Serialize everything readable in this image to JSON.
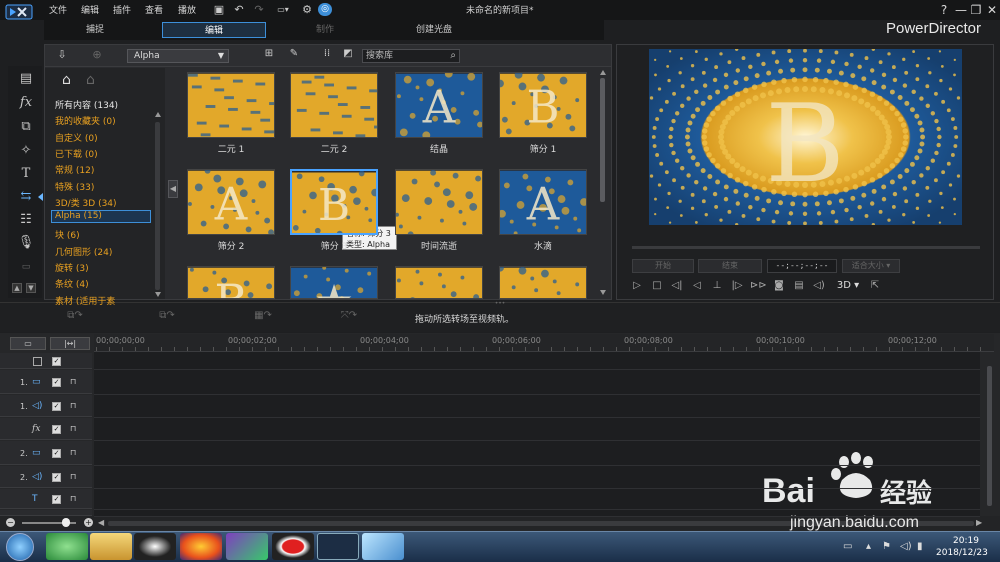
{
  "app": {
    "menu": [
      "文件",
      "编辑",
      "插件",
      "查看",
      "播放"
    ],
    "doc_title": "未命名的新项目*",
    "brand": "PowerDirector",
    "window_buttons": [
      "?",
      "—",
      "❐",
      "✕"
    ]
  },
  "modes": {
    "capture": "捕捉",
    "edit": "编辑",
    "produce": "制作",
    "disc": "创建光盘"
  },
  "library": {
    "filter_value": "Alpha",
    "search_placeholder": "搜索库",
    "categories": [
      {
        "label": "所有内容 (134)",
        "style": "white"
      },
      {
        "label": "我的收藏夹 (0)",
        "style": "orange"
      },
      {
        "label": "自定义 (0)",
        "style": "orange"
      },
      {
        "label": "已下载 (0)",
        "style": "orange"
      },
      {
        "label": "常规 (12)",
        "style": "orange"
      },
      {
        "label": "特殊 (33)",
        "style": "orange"
      },
      {
        "label": "3D/类 3D (34)",
        "style": "orange"
      },
      {
        "label": "Alpha (15)",
        "style": "selected"
      },
      {
        "label": "块 (6)",
        "style": "orange"
      },
      {
        "label": "几何图形 (24)",
        "style": "orange"
      },
      {
        "label": "旋转 (3)",
        "style": "orange"
      },
      {
        "label": "条纹 (4)",
        "style": "orange"
      },
      {
        "label": "素材 (适用于素",
        "style": "orange"
      }
    ],
    "thumbnails": [
      {
        "label": "二元 1",
        "glyph": ""
      },
      {
        "label": "二元 2",
        "glyph": ""
      },
      {
        "label": "结晶",
        "glyph": "A"
      },
      {
        "label": "筛分 1",
        "glyph": "B"
      },
      {
        "label": "筛分 2",
        "glyph": "A"
      },
      {
        "label": "筛分 3",
        "glyph": "B"
      },
      {
        "label": "时间流逝",
        "glyph": ""
      },
      {
        "label": "水滴",
        "glyph": "A"
      },
      {
        "label": "",
        "glyph": "B"
      },
      {
        "label": "",
        "glyph": "★"
      },
      {
        "label": "",
        "glyph": ""
      },
      {
        "label": "",
        "glyph": ""
      }
    ],
    "tooltip": {
      "name": "名称: 筛分 3",
      "type": "类型: Alpha"
    }
  },
  "preview": {
    "glyph": "B",
    "buttons": [
      "开始",
      "结束"
    ],
    "timecode": "--;--;--;--",
    "size_label": "适合大小",
    "mode_3d": "3D"
  },
  "edit_toolbar": {
    "hint": "拖动所选转场至视频轨。"
  },
  "timeline": {
    "ruler": [
      "00;00;00;00",
      "00;00;02;00",
      "00;00;04;00",
      "00;00;06;00",
      "00;00;08;00",
      "00;00;10;00",
      "00;00;12;00"
    ],
    "tracks": [
      {
        "num": "",
        "icon": ""
      },
      {
        "num": "1.",
        "icon": "video"
      },
      {
        "num": "1.",
        "icon": "audio"
      },
      {
        "num": "",
        "icon": "fx"
      },
      {
        "num": "2.",
        "icon": "video"
      },
      {
        "num": "2.",
        "icon": "audio"
      },
      {
        "num": "",
        "icon": "T"
      },
      {
        "num": "",
        "icon": ""
      }
    ]
  },
  "taskbar": {
    "time": "20:19",
    "date": "2018/12/23"
  },
  "watermark": {
    "text": "jingyan.baidu.com"
  },
  "colors": {
    "accent_blue": "#3d8fd8",
    "category_orange": "#e8a020",
    "thumb_blue": "#1e5a9a",
    "thumb_gold": "#e2a82a"
  }
}
